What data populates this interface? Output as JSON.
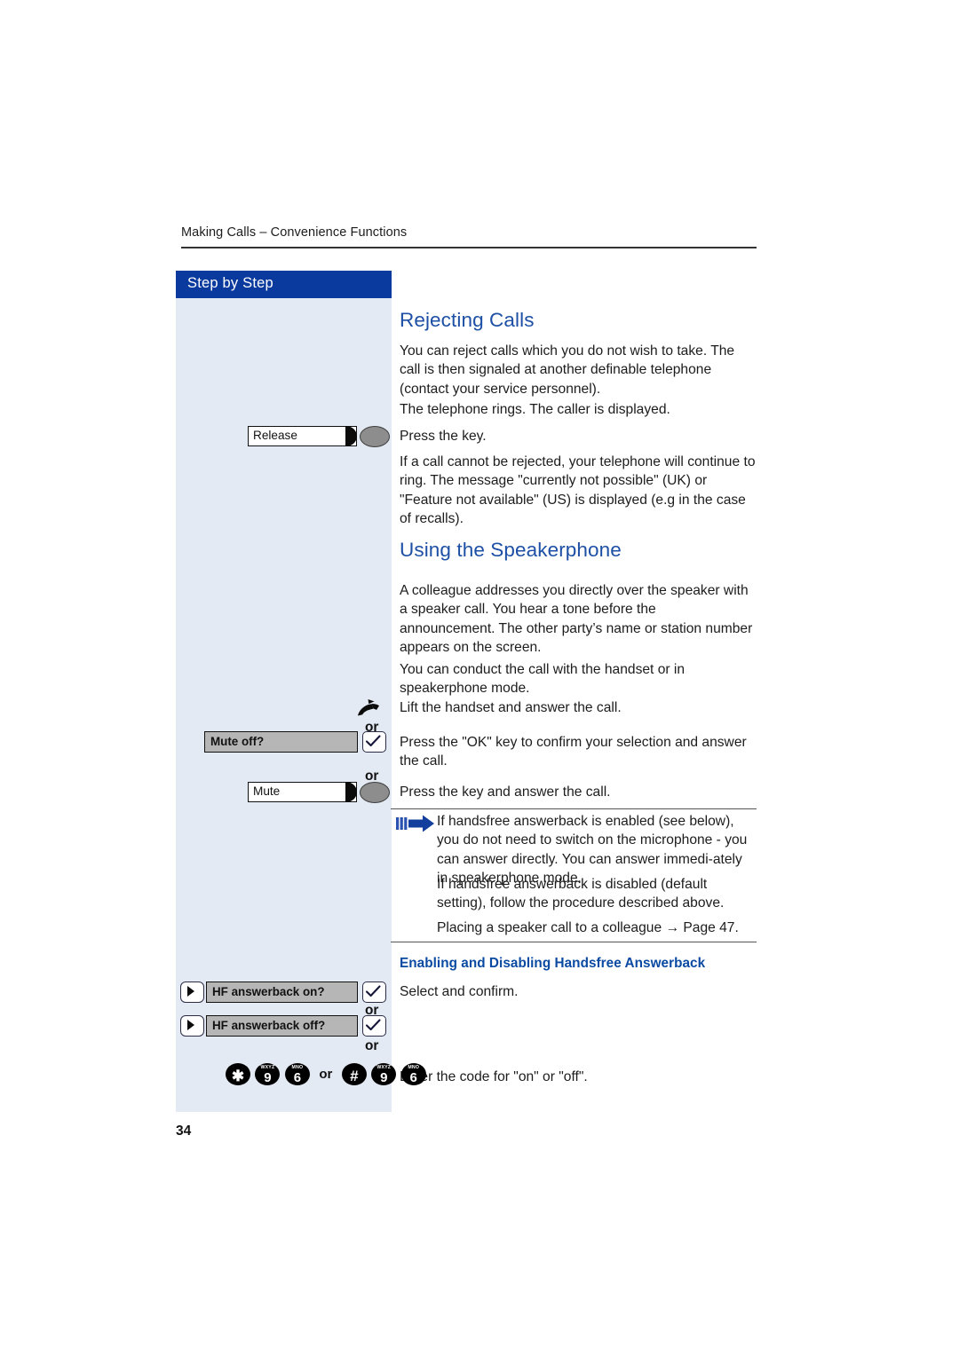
{
  "document": {
    "running_header": "Making Calls – Convenience Functions",
    "page_number": "34",
    "accent_blue": "#1d4fa5",
    "sidebar_blue": "#0a3a9e",
    "sidebar_bg": "#e4eaf4"
  },
  "sidebar": {
    "title": "Step by Step",
    "release_key": {
      "label": "Release",
      "icon": "phone-key-with-lamp"
    },
    "handset": {
      "icon": "lifted-handset-icon"
    },
    "or_1": "or",
    "mute_off_softkey": {
      "label": "Mute off?",
      "confirm_icon": "ok-checkmark-key"
    },
    "or_2": "or",
    "mute_key": {
      "label": "Mute",
      "icon": "phone-key-with-lamp"
    },
    "hf_on_softkey": {
      "nav_icon": "navigation-right-key",
      "label": "HF answerback on?",
      "confirm_icon": "ok-checkmark-key"
    },
    "or_3": "or",
    "hf_off_softkey": {
      "nav_icon": "navigation-right-key",
      "label": "HF answerback off?",
      "confirm_icon": "ok-checkmark-key"
    },
    "or_4": "or",
    "keypad": {
      "sequence_a": [
        {
          "glyph": "✱",
          "letters": ""
        },
        {
          "glyph": "9",
          "letters": "WXYZ"
        },
        {
          "glyph": "6",
          "letters": "MNO"
        }
      ],
      "or": "or",
      "sequence_b": [
        {
          "glyph": "#",
          "letters": ""
        },
        {
          "glyph": "9",
          "letters": "WXYZ"
        },
        {
          "glyph": "6",
          "letters": "MNO"
        }
      ]
    }
  },
  "main": {
    "rejecting_calls": {
      "heading": "Rejecting Calls",
      "para_1": "You can reject calls which you do not wish to take. The call is then signaled at another definable telephone (contact your service personnel).",
      "para_2": "The telephone rings. The caller is displayed.",
      "para_3": "Press the key.",
      "para_4": "If a call cannot be rejected, your telephone will continue to ring. The message \"currently not possible\" (UK) or \"Feature not available\" (US) is displayed (e.g in the case of recalls)."
    },
    "using_speakerphone": {
      "heading": "Using the Speakerphone",
      "para_1": "A colleague addresses you directly over the speaker with a speaker call. You hear a tone before the announcement. The other party’s name or station number appears on the screen.",
      "para_2": "You can conduct the call with the handset or in speakerphone mode.",
      "para_3": "Lift the handset and answer the call.",
      "para_4": "Press the \"OK\" key to confirm your selection and answer the call.",
      "para_5": "Press the key and answer the call."
    },
    "note": {
      "icon": "note-arrow-icon",
      "para_1": "If handsfree answerback is enabled (see below), you do not need to switch on the microphone - you can answer directly. You can answer immedi-ately in speakerphone mode.",
      "para_2": "If handsfree answerback is disabled (default setting), follow the procedure described above.",
      "para_3": "Placing a speaker call to a colleague → Page 47."
    },
    "handsfree_answerback": {
      "heading": "Enabling and Disabling Handsfree Answerback",
      "para_1": "Select and confirm.",
      "para_2": "Enter the code for \"on\" or \"off\"."
    }
  }
}
